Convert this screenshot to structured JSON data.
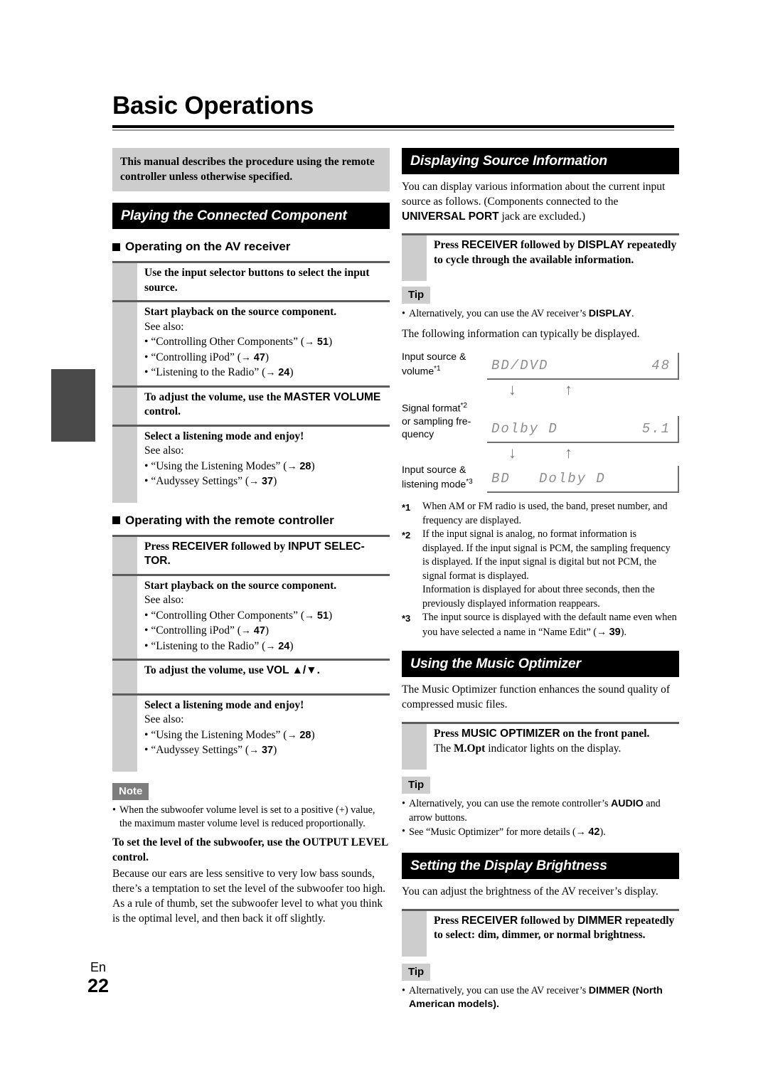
{
  "document": {
    "page_title": "Basic Operations",
    "footer_language": "En",
    "footer_page_number": "22"
  },
  "left_column": {
    "notice": "This manual describes the procedure using the remote controller unless otherwise specified.",
    "section_heading": "Playing the Connected Component",
    "subsection_1": {
      "heading": "Operating on the AV receiver",
      "steps": [
        {
          "title": "Use the input selector buttons to select the input source.",
          "see_also_label": "",
          "bullets": []
        },
        {
          "title": "Start playback on the source component.",
          "see_also_label": "See also:",
          "bullets": [
            {
              "text": "“Controlling Other Components”",
              "page": "51"
            },
            {
              "text": "“Controlling iPod”",
              "page": "47"
            },
            {
              "text": "“Listening to the Radio”",
              "page": "24"
            }
          ]
        },
        {
          "title": "To adjust the volume, use the MASTER VOLUME control.",
          "title_plain": "To adjust the volume, use the ",
          "title_emph": "MASTER VOLUME",
          "title_tail": " control.",
          "see_also_label": "",
          "bullets": []
        },
        {
          "title": "Select a listening mode and enjoy!",
          "see_also_label": "See also:",
          "bullets": [
            {
              "text": "“Using the Listening Modes”",
              "page": "28"
            },
            {
              "text": "“Audyssey Settings”",
              "page": "37"
            }
          ]
        }
      ]
    },
    "subsection_2": {
      "heading": "Operating with the remote controller",
      "steps": [
        {
          "title_plain": "Press ",
          "title_emph": "RECEIVER",
          "title_mid": " followed by ",
          "title_emph2": "INPUT SELEC-TOR.",
          "see_also_label": "",
          "bullets": []
        },
        {
          "title": "Start playback on the source component.",
          "see_also_label": "See also:",
          "bullets": [
            {
              "text": "“Controlling Other Components”",
              "page": "51"
            },
            {
              "text": "“Controlling iPod”",
              "page": "47"
            },
            {
              "text": "“Listening to the Radio”",
              "page": "24"
            }
          ]
        },
        {
          "title_plain": "To adjust the volume, use ",
          "title_emph": "VOL ▲/▼.",
          "see_also_label": "",
          "bullets": []
        },
        {
          "title": "Select a listening mode and enjoy!",
          "see_also_label": "See also:",
          "bullets": [
            {
              "text": "“Using the Listening Modes”",
              "page": "28"
            },
            {
              "text": "“Audyssey Settings”",
              "page": "37"
            }
          ]
        }
      ]
    },
    "note": {
      "badge": "Note",
      "item": "When the subwoofer volume level is set to a positive (+) value, the maximum master volume level is reduced proportionally."
    },
    "subwoofer": {
      "bold_lead": "To set the level of the subwoofer, use the OUTPUT LEVEL control.",
      "body": "Because our ears are less sensitive to very low bass sounds, there’s a temptation to set the level of the subwoofer too high. As a rule of thumb, set the subwoofer level to what you think is the optimal level, and then back it off slightly."
    }
  },
  "right_column": {
    "source_info": {
      "heading": "Displaying Source Information",
      "intro_a": "You can display various information about the current input source as follows. (Components connected to the ",
      "intro_emph": "UNIVERSAL PORT",
      "intro_b": " jack are excluded.)",
      "step": {
        "plain": "Press ",
        "emph1": "RECEIVER",
        "mid": " followed by ",
        "emph2": "DISPLAY",
        "tail": " repeatedly to cycle through the available information."
      },
      "tip": {
        "badge": "Tip",
        "item_a": "Alternatively, you can use the AV receiver’s ",
        "item_emph": "DISPLAY",
        "item_b": "."
      },
      "following": "The following information can typically be displayed.",
      "diagram": {
        "rows": [
          {
            "label_line1": "Input source &",
            "label_line2": "volume",
            "label_sup": "*1",
            "lcd_left": "BD/DVD",
            "lcd_right": "48"
          },
          {
            "label_line1": "Signal format",
            "label_sup": "*2",
            "label_line2": "or sampling fre-",
            "label_line3": "quency",
            "lcd_left": "Dolby D",
            "lcd_right": "5.1"
          },
          {
            "label_line1": "Input source &",
            "label_line2": "listening mode",
            "label_sup": "*3",
            "lcd_left": "BD   Dolby D",
            "lcd_right": ""
          }
        ],
        "arrow_down": "↓",
        "arrow_up": "↑"
      },
      "footnotes": [
        {
          "mark": "*1",
          "text": "When AM or FM radio is used, the band, preset number, and frequency are displayed."
        },
        {
          "mark": "*2",
          "text": "If the input signal is analog, no format information is displayed. If the input signal is PCM, the sampling frequency is displayed. If the input signal is digital but not PCM, the signal format is displayed.",
          "continuation": "Information is displayed for about three seconds, then the previously displayed information reappears."
        },
        {
          "mark": "*3",
          "text_a": "The input source is displayed with the default name even when you have selected a name in “Name Edit” (",
          "page": "39",
          "text_b": ")."
        }
      ]
    },
    "music_optimizer": {
      "heading": "Using the Music Optimizer",
      "intro": "The Music Optimizer function enhances the sound quality of compressed music files.",
      "step": {
        "plain": "Press ",
        "emph": "MUSIC OPTIMIZER",
        "tail": " on the front panel.",
        "sub_a": "The ",
        "sub_emph": "M.Opt",
        "sub_b": " indicator lights on the display."
      },
      "tip": {
        "badge": "Tip",
        "items": [
          {
            "text_a": "Alternatively, you can use the remote controller’s ",
            "emph": "AUDIO",
            "text_b": " and arrow buttons."
          },
          {
            "text_a": "See “Music Optimizer” for more details (",
            "page": "42",
            "text_b": ")."
          }
        ]
      }
    },
    "display_brightness": {
      "heading": "Setting the Display Brightness",
      "intro": "You can adjust the brightness of the AV receiver’s display.",
      "step": {
        "plain": "Press ",
        "emph1": "RECEIVER",
        "mid": " followed by ",
        "emph2": "DIMMER",
        "tail": " repeatedly to select: dim, dimmer, or normal brightness."
      },
      "tip": {
        "badge": "Tip",
        "item_a": "Alternatively, you can use the AV receiver’s ",
        "item_emph": "DIMMER",
        "item_b": " (North American models)."
      }
    }
  },
  "colors": {
    "header_bar": "#000000",
    "notice_bg": "#cdcdcd",
    "gutter": "#cdcdcd",
    "note_badge": "#7d7d7d",
    "tip_badge": "#cdcdcd",
    "margin_tab": "#4a4a4a",
    "rule": "#5c5c5c",
    "lcd_text": "#8d8d8d"
  }
}
